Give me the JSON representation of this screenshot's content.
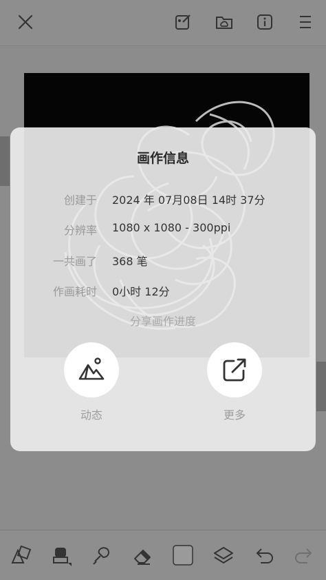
{
  "dialog": {
    "title": "画作信息",
    "rows": [
      {
        "key": "创建于",
        "value": "2024 年 07月08日 14时 37分"
      },
      {
        "key": "分辨率",
        "value": "1080 x 1080 - 300ppi"
      },
      {
        "key": "一共画了",
        "value": "368 笔"
      },
      {
        "key": "作画耗时",
        "value": "0小时 12分"
      }
    ],
    "share_progress": "分享画作进度",
    "actions": [
      {
        "label": "动态",
        "icon": "mountain-image-icon"
      },
      {
        "label": "更多",
        "icon": "share-external-icon"
      }
    ]
  },
  "topbar": {
    "icons": [
      "close-icon",
      "edit-canvas-icon",
      "folder-cloud-icon",
      "info-icon",
      "menu-icon"
    ]
  },
  "bottombar": {
    "icons": [
      "shapes-icon",
      "brush-icon",
      "smudge-icon",
      "eraser-icon",
      "color-swatch",
      "layers-icon",
      "undo-icon",
      "redo-icon"
    ]
  },
  "colors": {
    "overlay_bg": "#8f8f8f",
    "dialog_bg": "#ececec",
    "canvas": "#050505"
  }
}
